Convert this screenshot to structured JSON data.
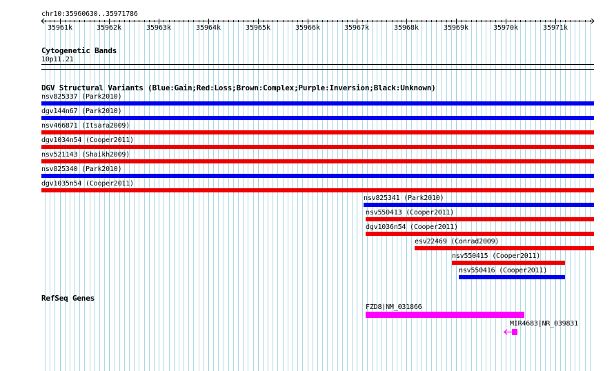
{
  "coordinate_label": "chr10:35960630..35971786",
  "ruler": {
    "ticks": [
      "35961k",
      "35962k",
      "35963k",
      "35964k",
      "35965k",
      "35966k",
      "35967k",
      "35968k",
      "35969k",
      "35970k",
      "35971k"
    ]
  },
  "cytoband": {
    "title": "Cytogenetic Bands",
    "band": "10p11.21"
  },
  "dgv": {
    "title": "DGV Structural Variants (Blue:Gain;Red:Loss;Brown:Complex;Purple:Inversion;Black:Unknown)",
    "variants": [
      {
        "label": "nsv825337 (Park2010)",
        "type": "Gain",
        "start": 35960630,
        "end": 35971786
      },
      {
        "label": "dgv144n67 (Park2010)",
        "type": "Gain",
        "start": 35960630,
        "end": 35971786
      },
      {
        "label": "nsv466871 (Itsara2009)",
        "type": "Loss",
        "start": 35960630,
        "end": 35971786
      },
      {
        "label": "dgv1034n54 (Cooper2011)",
        "type": "Loss",
        "start": 35960630,
        "end": 35971786
      },
      {
        "label": "nsv521143 (Shaikh2009)",
        "type": "Loss",
        "start": 35960630,
        "end": 35971786
      },
      {
        "label": "nsv825340 (Park2010)",
        "type": "Gain",
        "start": 35960630,
        "end": 35971786
      },
      {
        "label": "dgv1035n54 (Cooper2011)",
        "type": "Loss",
        "start": 35960630,
        "end": 35971786
      },
      {
        "label": "nsv825341 (Park2010)",
        "type": "Gain",
        "start": 35967130,
        "end": 35971786
      },
      {
        "label": "nsv550413 (Cooper2011)",
        "type": "Loss",
        "start": 35967180,
        "end": 35971786
      },
      {
        "label": "dgv1036n54 (Cooper2011)",
        "type": "Loss",
        "start": 35967180,
        "end": 35971786
      },
      {
        "label": "esv22469 (Conrad2009)",
        "type": "Loss",
        "start": 35968160,
        "end": 35971786
      },
      {
        "label": "nsv550415 (Cooper2011)",
        "type": "Loss",
        "start": 35968910,
        "end": 35971200
      },
      {
        "label": "nsv550416 (Cooper2011)",
        "type": "Gain",
        "start": 35969050,
        "end": 35971200
      }
    ]
  },
  "refseq": {
    "title": "RefSeq Genes",
    "genes": [
      {
        "label": "FZD8|NM_031866",
        "start": 35967180,
        "end": 35970380,
        "color": "#ff00ff"
      },
      {
        "label": "MIR4683|NR_039831",
        "start": 35970130,
        "end": 35970240,
        "color": "#ff00ff",
        "strand": "-"
      }
    ]
  },
  "colors": {
    "Gain": "#0000ee",
    "Loss": "#ee0000",
    "gene": "#ff00ff",
    "grid": "#add8e6"
  }
}
